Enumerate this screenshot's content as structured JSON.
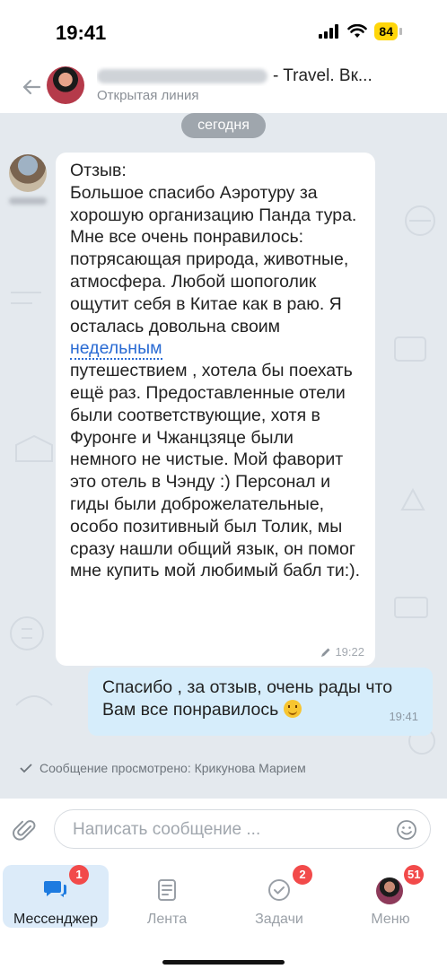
{
  "status_bar": {
    "time": "19:41",
    "battery": "84"
  },
  "header": {
    "title_suffix": "- Travel. Вк...",
    "subtitle": "Открытая линия"
  },
  "chat": {
    "date_label": "сегодня",
    "incoming": {
      "text_before_link": "Отзыв:\nБольшое спасибо Аэротуру за хорошую организацию Панда тура. Мне все очень понравилось: потрясающая природа, животные, атмосфера. Любой шопоголик ощутит себя в Китае как в раю. Я осталась довольна своим ",
      "link_text": "недельным",
      "text_after_link": "\nпутешествием , хотела бы поехать ещё раз. Предоставленные отели были соответствующие, хотя в Фуронге и Чжанцзяце были немного не чистые. Мой фаворит это отель в Чэнду :) Персонал и гиды были доброжелательные, особо позитивный был Толик, мы сразу нашли общий язык, он помог мне купить мой любимый бабл ти:).",
      "time": "19:22"
    },
    "outgoing": {
      "text": "Спасибо , за отзыв, очень рады что Вам все понравилось",
      "time": "19:41"
    },
    "viewed_status": "Сообщение просмотрено: Крикунова Марием"
  },
  "input": {
    "placeholder": "Написать сообщение ..."
  },
  "tabs": [
    {
      "label": "Мессенджер",
      "badge": "1",
      "icon": "messenger-icon"
    },
    {
      "label": "Лента",
      "icon": "feed-icon"
    },
    {
      "label": "Задачи",
      "badge": "2",
      "icon": "tasks-icon"
    },
    {
      "label": "Меню",
      "badge": "51",
      "icon": "avatar"
    }
  ],
  "colors": {
    "accent": "#2a6bd3",
    "badge": "#f24a4a",
    "outgoing_bubble": "#d6edfb",
    "active_tab": "#dcebf9"
  }
}
